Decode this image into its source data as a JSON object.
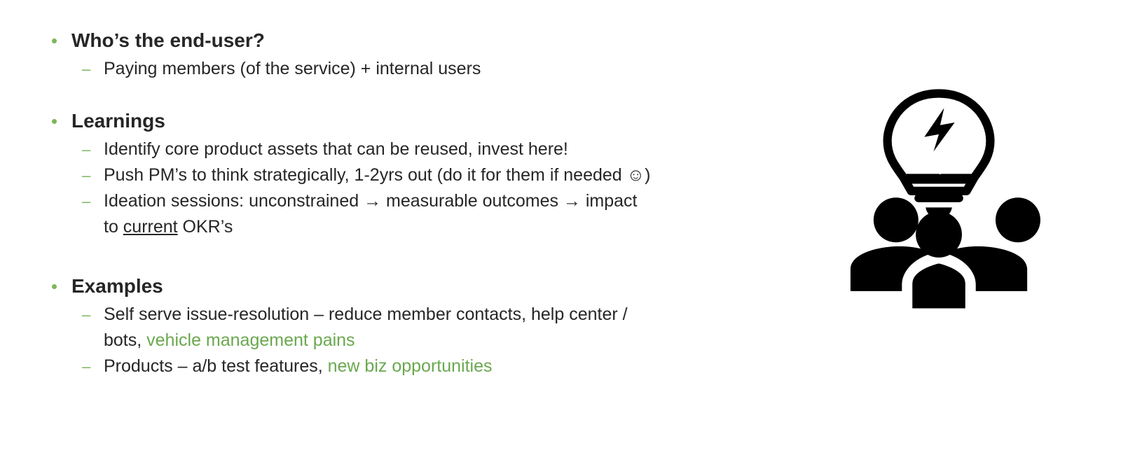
{
  "slide": {
    "accent_color": "#7fb55a",
    "highlight_color": "#6aa84f",
    "sections": [
      {
        "heading": "Who’s the end-user?",
        "items": [
          {
            "text": "Paying members (of the service) + internal users"
          }
        ]
      },
      {
        "heading": "Learnings",
        "items": [
          {
            "text": "Identify core product assets that can be reused, invest here!"
          },
          {
            "text": "Push PM’s to think strategically, 1-2yrs out (do it for them if needed ☺)"
          },
          {
            "text_a": "Ideation sessions: unconstrained → measurable outcomes → impact",
            "text_b": "to ",
            "text_underline": "current",
            "text_c": " OKR’s"
          }
        ]
      },
      {
        "heading": "Examples",
        "items": [
          {
            "text_a": "Self serve issue-resolution – reduce member contacts, help center /",
            "text_b": "bots, ",
            "text_green": "vehicle management pains"
          },
          {
            "text_a": "Products – a/b test features, ",
            "text_green": "new biz opportunities"
          }
        ]
      }
    ],
    "illustration": "team-ideas-icon"
  }
}
